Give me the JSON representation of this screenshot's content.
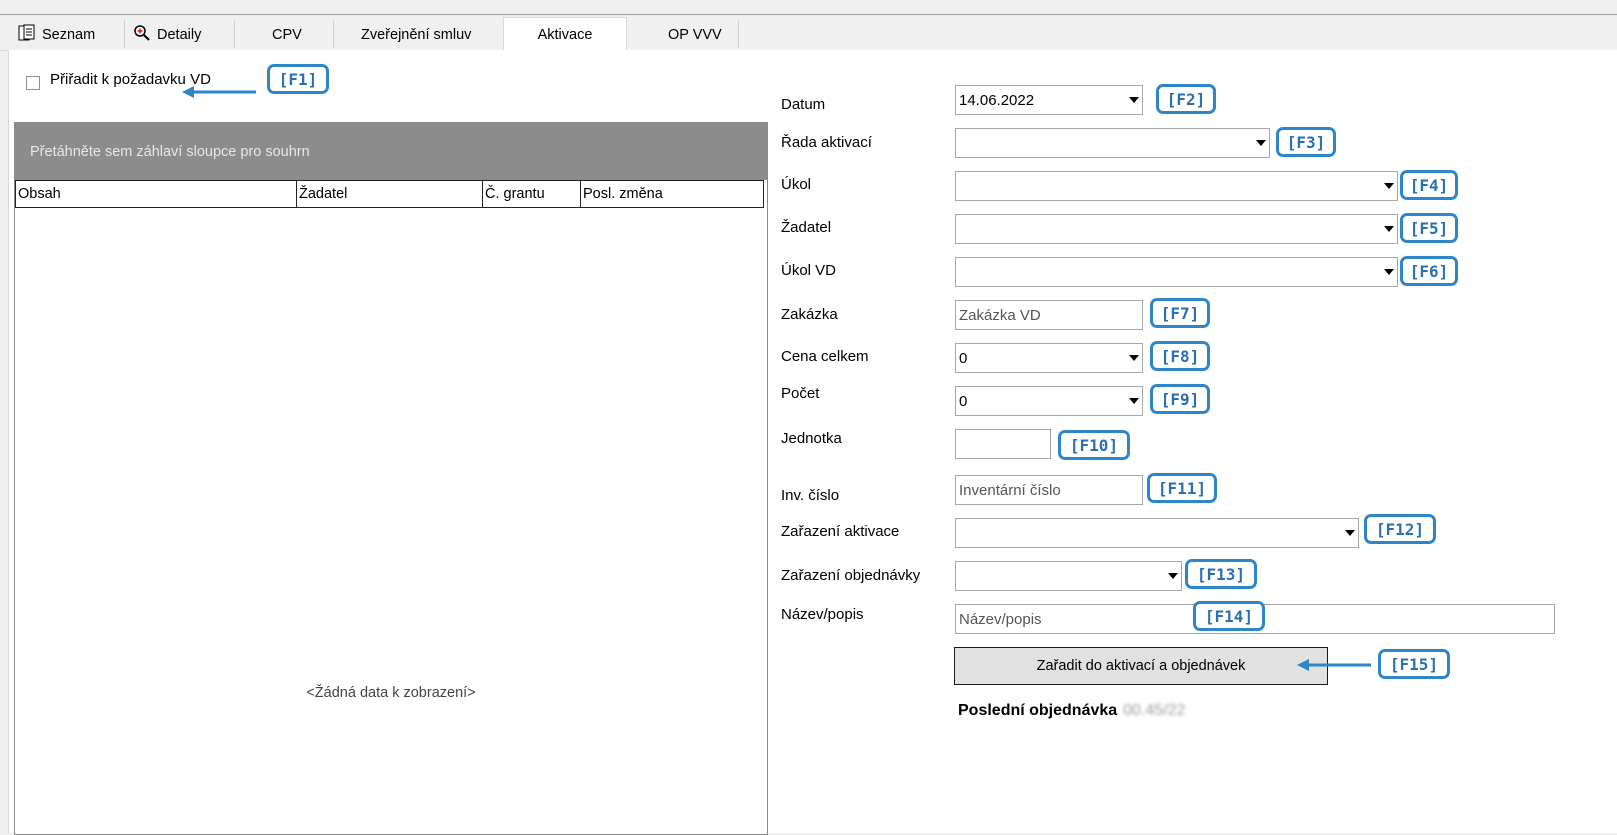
{
  "tabs": [
    {
      "label": "Seznam",
      "icon": "list-icon"
    },
    {
      "label": "Detaily",
      "icon": "magnifier-icon"
    },
    {
      "label": "CPV"
    },
    {
      "label": "Zveřejnění smluv"
    },
    {
      "label": "Aktivace",
      "active": true
    },
    {
      "label": "OP VVV"
    }
  ],
  "left": {
    "checkbox_label": "Přiřadit k požadavku VD",
    "checkbox_checked": false,
    "group_placeholder": "Přetáhněte sem záhlaví sloupce pro souhrn",
    "columns": [
      "Obsah",
      "Žadatel",
      "Č. grantu",
      "Posl. změna"
    ],
    "no_data": "<Žádná data k zobrazení>"
  },
  "form": {
    "datum_label": "Datum",
    "datum_value": "14.06.2022",
    "rada_label": "Řada aktivací",
    "rada_value": "",
    "ukol_label": "Úkol",
    "ukol_value": "",
    "zadatel_label": "Žadatel",
    "zadatel_value": "",
    "ukolvd_label": "Úkol VD",
    "ukolvd_value": "",
    "zakazka_label": "Zakázka",
    "zakazka_placeholder": "Zakázka VD",
    "cena_label": "Cena celkem",
    "cena_value": "0",
    "pocet_label": "Počet",
    "pocet_value": "0",
    "jednotka_label": "Jednotka",
    "jednotka_value": "",
    "inv_label": "Inv. číslo",
    "inv_placeholder": "Inventární číslo",
    "zarazeni_akt_label": "Zařazení aktivace",
    "zarazeni_akt_value": "",
    "zarazeni_obj_label": "Zařazení objednávky",
    "zarazeni_obj_value": "",
    "nazev_label": "Název/popis",
    "nazev_placeholder": "Název/popis",
    "submit_label": "Zařadit do aktivací a objednávek",
    "last_order_label": "Poslední objednávka",
    "last_order_value": "00.45/22"
  },
  "annotations": [
    "[F1]",
    "[F2]",
    "[F3]",
    "[F4]",
    "[F5]",
    "[F6]",
    "[F7]",
    "[F8]",
    "[F9]",
    "[F10]",
    "[F11]",
    "[F12]",
    "[F13]",
    "[F14]",
    "[F15]"
  ],
  "colors": {
    "annotation": "#2e86c8",
    "group_area": "#8c8c8c",
    "button": "#e1e1e1"
  }
}
